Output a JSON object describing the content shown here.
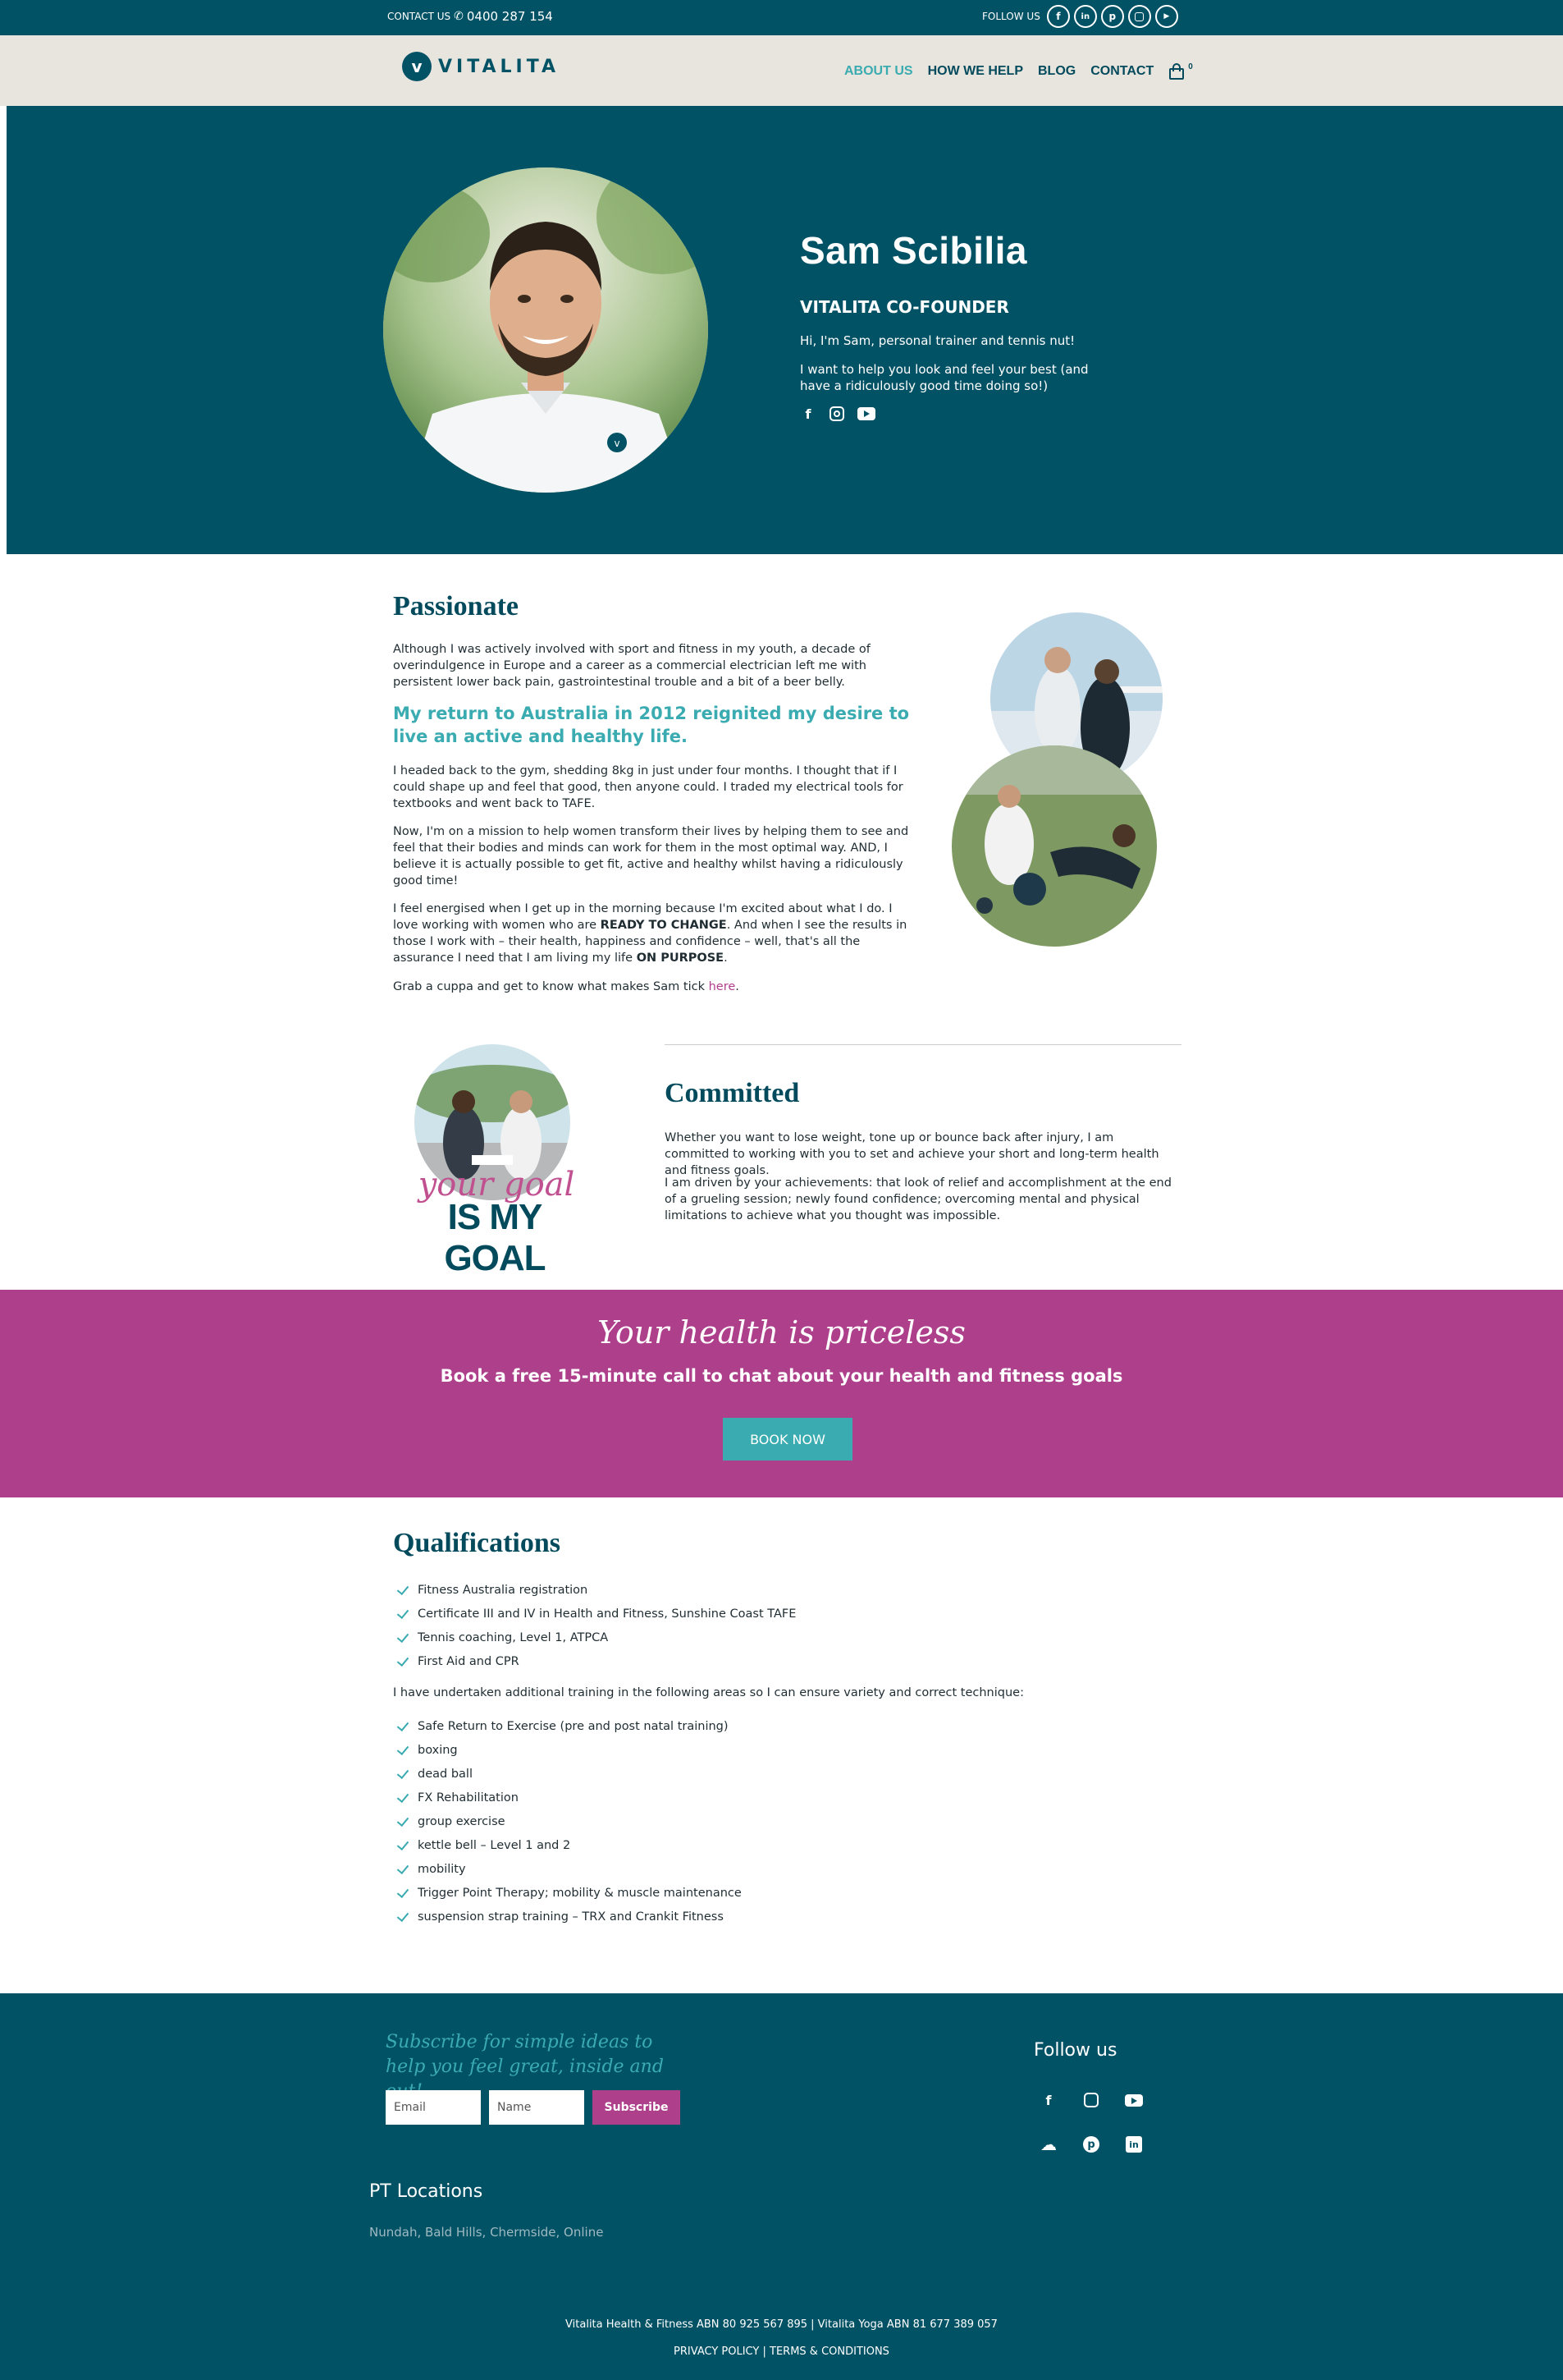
{
  "topbar": {
    "contact_label": "CONTACT US",
    "phone": "0400 287 154",
    "follow_label": "FOLLOW US",
    "social_icons": [
      "facebook-icon",
      "linkedin-icon",
      "pinterest-icon",
      "instagram-icon",
      "youtube-icon"
    ]
  },
  "header": {
    "logo_text": "VITALITA",
    "nav": [
      {
        "label": "ABOUT US",
        "active": true
      },
      {
        "label": "HOW WE HELP",
        "active": false
      },
      {
        "label": "BLOG",
        "active": false
      },
      {
        "label": "CONTACT",
        "active": false
      }
    ],
    "cart_count": "0"
  },
  "hero": {
    "name": "Sam Scibilia",
    "role": "VITALITA CO-FOUNDER",
    "intro": "Hi, I'm Sam, personal trainer and tennis nut!",
    "mission": "I want to help you look and feel your best (and have a ridiculously good time doing so!)"
  },
  "passionate": {
    "heading": "Passionate",
    "p1": "Although I was actively involved with sport and fitness in my youth, a decade of overindulgence in Europe and a career as a commercial electrician left me with persistent lower back pain, gastrointestinal trouble and a bit of a beer belly.",
    "highlight": "My return to Australia in 2012 reignited my desire to live an active and healthy life.",
    "p2": "I headed back to the gym, shedding 8kg in just under four months. I thought that if I could shape up and feel that good, then anyone could. I traded my electrical tools for textbooks and went back to TAFE.",
    "p3": "Now, I'm on a mission to help women transform their lives by helping them to see and feel that their bodies and minds can work for them in the most optimal way. AND, I believe it is actually possible to get fit, active and healthy whilst having a ridiculously good time!",
    "p4_a": "I feel energised when I get up in the morning because I'm excited about what I do. I love working with women who are ",
    "p4_b": "READY TO CHANGE",
    "p4_c": ". And when I see the results in those I work with – their health, happiness and confidence – well, that's all the assurance I need that I am living my life ",
    "p4_d": "ON PURPOSE",
    "p4_e": ".",
    "p5_a": "Grab a cuppa and get to know what makes Sam tick ",
    "p5_link": "here",
    "p5_b": "."
  },
  "committed": {
    "graphic_script": "your goal",
    "graphic_bold": "IS MY GOAL",
    "heading": "Committed",
    "p1": "Whether you want to lose weight, tone up or bounce back after injury, I am committed to working with you to set and achieve your short and long-term health and fitness goals.",
    "p2": "I am driven by your achievements: that look of relief and accomplishment at the end of a grueling session; newly found confidence; overcoming mental and physical limitations to achieve what you thought was impossible."
  },
  "banner": {
    "script": "Your health is priceless",
    "subtitle": "Book a free 15-minute call to chat about your health and fitness goals",
    "button": "BOOK NOW"
  },
  "qualifications": {
    "heading": "Qualifications",
    "list1": [
      "Fitness Australia registration",
      "Certificate III and IV in Health and Fitness, Sunshine Coast TAFE",
      "Tennis coaching, Level 1, ATPCA",
      "First Aid and CPR"
    ],
    "intro2": "I have undertaken additional training in the following areas so I can ensure variety and correct technique:",
    "list2": [
      "Safe Return to Exercise (pre and post natal training)",
      "boxing",
      "dead ball",
      "FX Rehabilitation",
      "group exercise",
      "kettle bell – Level 1 and 2",
      "mobility",
      "Trigger Point Therapy; mobility & muscle maintenance",
      "suspension strap training – TRX and Crankit Fitness"
    ]
  },
  "footer": {
    "subscribe_script": "Subscribe for simple ideas to help you feel great, inside and out!",
    "email_placeholder": "Email",
    "name_placeholder": "Name",
    "subscribe_button": "Subscribe",
    "locations_heading": "PT Locations",
    "locations": "Nundah, Bald Hills, Chermside, Online",
    "follow_heading": "Follow us",
    "copyright": "Vitalita Health & Fitness ABN 80 925 567 895 | Vitalita Yoga ABN 81 677 389 057",
    "privacy": "PRIVACY POLICY",
    "separator": "|",
    "terms": "TERMS & CONDITIONS"
  },
  "colors": {
    "teal_dark": "#025266",
    "teal_accent": "#3aabb0",
    "magenta": "#ae3f8b",
    "beige": "#e8e5de"
  }
}
